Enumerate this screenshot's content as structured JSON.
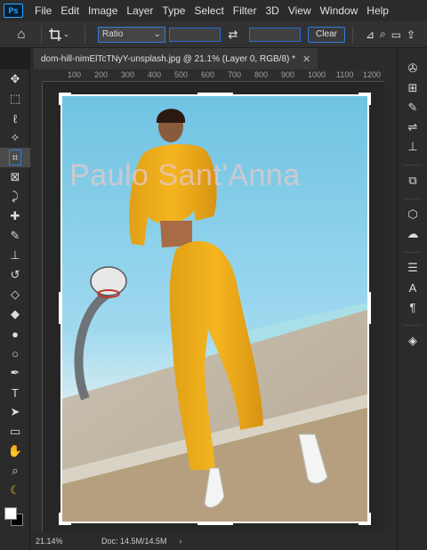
{
  "menu": {
    "logo": "Ps",
    "items": [
      "File",
      "Edit",
      "Image",
      "Layer",
      "Type",
      "Select",
      "Filter",
      "3D",
      "View",
      "Window",
      "Help"
    ]
  },
  "options": {
    "ratio_value": "Ratio",
    "clear_label": "Clear"
  },
  "document": {
    "tab_title": "dom-hill-nimElTcTNyY-unsplash.jpg @ 21.1% (Layer 0, RGB/8) *",
    "watermark": "Paulo Sant'Anna"
  },
  "ruler": {
    "labels": [
      "100",
      "200",
      "300",
      "400",
      "500",
      "600",
      "700",
      "800",
      "900",
      "1000",
      "1100",
      "1200"
    ]
  },
  "status": {
    "zoom": "21.14%",
    "doc_size": "Doc: 14.5M/14.5M"
  },
  "colors": {
    "foreground": "#ffffff",
    "background": "#000000",
    "accent": "#2f7de0"
  }
}
